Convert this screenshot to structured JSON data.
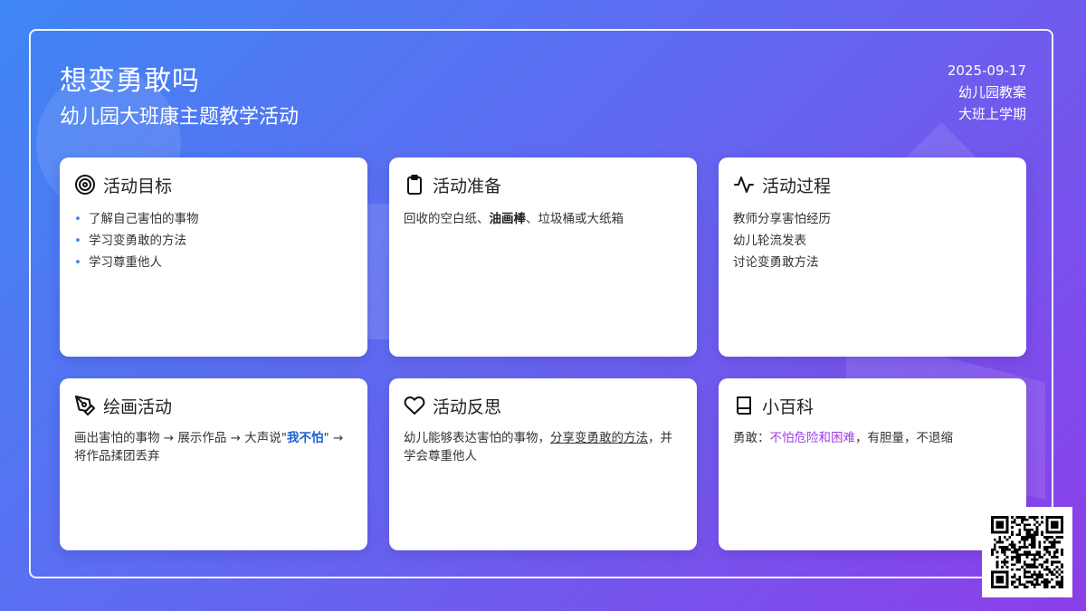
{
  "header": {
    "title": "想变勇敢吗",
    "subtitle": "幼儿园大班康主题教学活动",
    "date": "2025-09-17",
    "doc_type": "幼儿园教案",
    "term": "大班上学期"
  },
  "cards": {
    "goals": {
      "title": "活动目标",
      "icon": "target-icon",
      "items": [
        "了解自己害怕的事物",
        "学习变勇敢的方法",
        "学习尊重他人"
      ]
    },
    "prep": {
      "title": "活动准备",
      "icon": "clipboard-icon",
      "text_a": "回收的空白纸、",
      "text_bold": "油画棒",
      "text_b": "、垃圾桶或大纸箱"
    },
    "process": {
      "title": "活动过程",
      "icon": "activity-icon",
      "steps": [
        "教师分享害怕经历",
        "幼儿轮流发表",
        "讨论变勇敢方法"
      ]
    },
    "drawing": {
      "title": "绘画活动",
      "icon": "pen-tool-icon",
      "text_a": "画出害怕的事物 → 展示作品 → 大声说\"",
      "text_em": "我不怕",
      "text_b": "\" → 将作品揉团丢弃"
    },
    "reflection": {
      "title": "活动反思",
      "icon": "heart-icon",
      "text_a": "幼儿能够表达害怕的事物，",
      "text_under": "分享变勇敢的方法",
      "text_b": "，并学会尊重他人"
    },
    "encyclopedia": {
      "title": "小百科",
      "icon": "book-icon",
      "text_a": "勇敢：",
      "text_hl": "不怕危险和困难",
      "text_b": "，有胆量，不退缩"
    }
  },
  "colors": {
    "gradient_start": "#3f86f4",
    "gradient_end": "#8c3ee8",
    "bullet": "#3f86f4",
    "emphasis_blue": "#1f5fd0",
    "highlight_purple": "#9b3ee6"
  }
}
